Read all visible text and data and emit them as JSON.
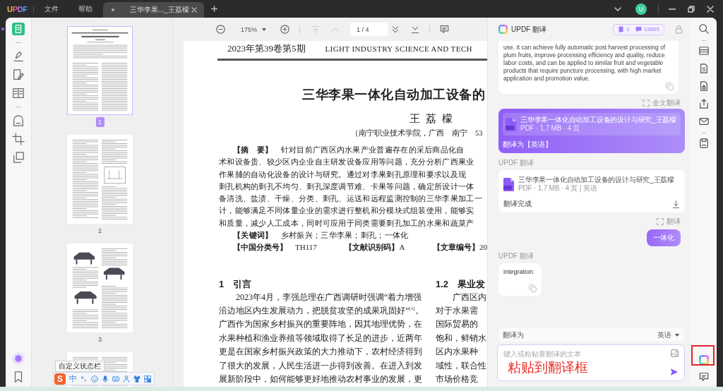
{
  "title_bar": {
    "logo": "UPDF",
    "menus": [
      "文件",
      "帮助"
    ],
    "tabs": [
      {
        "title": "三华李果..._王荔檬",
        "selected": true
      }
    ],
    "avatar": "U"
  },
  "left_toolbar": {
    "tools": [
      {
        "selected": true
      },
      {
        "selected": false
      },
      {
        "selected": false
      },
      {
        "selected": false
      },
      {
        "selected": false
      },
      {
        "selected": false
      },
      {
        "selected": false
      }
    ]
  },
  "thumbnails": [
    {
      "label": "1",
      "selected": true
    },
    {
      "label": "2",
      "selected": false
    },
    {
      "label": "3",
      "selected": false
    },
    {
      "selected": false
    }
  ],
  "toolbar": {
    "zoom": "175%",
    "nav_buttons": [
      {
        "disabled": true
      },
      {
        "disabled": true
      },
      {
        "disabled": false
      },
      {
        "disabled": false
      }
    ],
    "page_indicator": "1 / 4"
  },
  "document": {
    "issue": "2023年第39卷第5期",
    "journal": "LIGHT INDUSTRY SCIENCE AND TECH",
    "title": "三华李果一体化自动加工设备的",
    "author": "王 荔 檬",
    "affiliation": "（南宁职业技术学院，广西　南宁　53",
    "abstract": [
      "**【摘　要】**　针对目前广西区内水果产业普遍存在的采后商品化自",
      "术和设备贵、较少区内企业自主研发设备应用等问题，充分分析广西果业",
      "作果脯的自动化设备的设计与研究。通过对李果刺孔原理和要求以及现",
      "刺孔机构的刺孔不均匀、刺孔深度调节难、卡果等问题，确定所设计一体",
      "备清洗、盐渍、干燥、分类、刺孔、运送和远程监测控制的三华李果加工一",
      "计，能够满足不同体量企业的需求进行整机和分模块式组装使用，能够实",
      "和质量，减少人工成本，同时可应用于同类需要刺孔加工的水果和蔬菜产"
    ],
    "keywords": "**【关键词】**　乡村振兴；三华李果；刺孔；一体化",
    "identifiers": [
      "**【中国分类号】**　TH117",
      "**【文献识别码】**A",
      "**【文章编号】**20"
    ],
    "columns": [
      {
        "heading": "1　引言",
        "lines": [
          "2023年4月，李强总理在广西调研时强调“着力增强",
          "沿边地区内生发展动力，把脱贫攻坚的成果巩固好”$^{[1]}$。",
          "广西作为国家乡村振兴的重要阵地，因其地理优势，在",
          "水果种植和渔业养殖等领域取得了长足的进步，近两年",
          "更是在国家乡村振兴政策的大力推动下，农村经济得到",
          "了很大的发展，人民生活进一步得到改善。在进入到发",
          "展新阶段中，如何能够更好地推动农村事业的发展，更"
        ]
      },
      {
        "heading": "1.2　果业发",
        "lines": [
          "广西区内",
          "对于水果需",
          "国际贸易的",
          "饱和，鲜销水",
          "区内水果种",
          "域性，联合性",
          "市场价格竞"
        ]
      }
    ]
  },
  "translate_panel": {
    "title": "UPDF 翻译",
    "counters": [
      "1",
      "19655"
    ],
    "messages": [
      {
        "kind": "result_text",
        "text": "use. It can achieve fully automatic post harvest processing of plum fruits, improve processing efficiency and quality, reduce labor costs, and can be applied to similar fruit and vegetable products that require puncture processing, with high market application and promotion value."
      },
      {
        "kind": "action",
        "label": "全文翻译"
      },
      {
        "kind": "request_file",
        "file_name": "三华李果一体化自动加工设备的设计与研究_王荔檬",
        "file_meta": "PDF · 1.7 MB · 4 页",
        "instruction": "翻译为【英语】"
      },
      {
        "kind": "sender",
        "label": "UPDF 翻译"
      },
      {
        "kind": "result_file",
        "file_name": "三华李果一体化自动加工设备的设计与研究_王荔檬",
        "file_meta": "PDF · 1.7 MB · 4 页 | 英语",
        "status": "翻译完成"
      },
      {
        "kind": "action",
        "label": "翻译"
      },
      {
        "kind": "request_text",
        "text": "一体化"
      },
      {
        "kind": "sender",
        "label": "UPDF 翻译"
      },
      {
        "kind": "result_text",
        "text": "integration"
      }
    ],
    "target_language": {
      "label": "翻译为",
      "value": "英语"
    },
    "input": {
      "placeholder": "键入或粘贴要翻译的文本"
    },
    "annotation": "粘贴到翻译框"
  },
  "right_toolbar": {
    "translate_highlighted": true
  },
  "ime_toolbar": {
    "tooltip": "自定义状态栏",
    "logo": "S",
    "mode": "中"
  }
}
